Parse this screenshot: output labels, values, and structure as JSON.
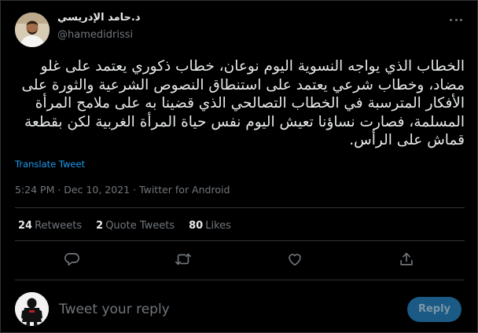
{
  "author": {
    "display_name": "د.حامد الإدريسي",
    "handle": "@hamedidrissi"
  },
  "tweet": {
    "text": "الخطاب الذي يواجه النسوية اليوم نوعان، خطاب ذكوري يعتمد على غلو مضاد، وخطاب شرعي يعتمد على استنطاق النصوص الشرعية والثورة على الأفكار المترسبة في الخطاب التصالحي الذي قضينا به على ملامح المرأة المسلمة، فصارت نساؤنا تعيش اليوم نفس حياة المرأة الغربية لكن بقطعة قماش على الرأس.",
    "translate_label": "Translate Tweet",
    "timestamp": "5:24 PM · Dec 10, 2021 · Twitter for Android"
  },
  "stats": {
    "retweets_count": "24",
    "retweets_label": "Retweets",
    "quotes_count": "2",
    "quotes_label": "Quote Tweets",
    "likes_count": "80",
    "likes_label": "Likes"
  },
  "actions": [
    "reply-icon",
    "retweet-icon",
    "like-icon",
    "share-icon"
  ],
  "reply": {
    "placeholder": "Tweet your reply",
    "button_label": "Reply"
  },
  "colors": {
    "background": "#000000",
    "text": "#e7e9ea",
    "secondary": "#71767b",
    "link": "#1d9bf0",
    "divider": "#2f3336",
    "reply_button_disabled": "#1a5a84"
  }
}
